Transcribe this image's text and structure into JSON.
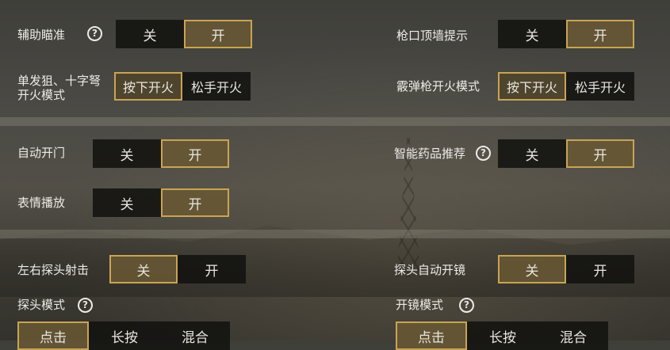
{
  "settings": {
    "aim_assist": {
      "label": "辅助瞄准",
      "off": "关",
      "on": "开"
    },
    "muzzle_wall_hint": {
      "label": "枪口顶墙提示",
      "off": "关",
      "on": "开"
    },
    "single_shot_fire": {
      "label_line1": "单发狙、十字弩",
      "label_line2": "开火模式",
      "press": "按下开火",
      "release": "松手开火"
    },
    "shotgun_fire": {
      "label": "霰弹枪开火模式",
      "press": "按下开火",
      "release": "松手开火"
    },
    "auto_door": {
      "label": "自动开门",
      "off": "关",
      "on": "开"
    },
    "smart_meds": {
      "label": "智能药品推荐",
      "off": "关",
      "on": "开"
    },
    "emote_play": {
      "label": "表情播放",
      "off": "关",
      "on": "开"
    },
    "peek_fire": {
      "label": "左右探头射击",
      "off": "关",
      "on": "开"
    },
    "peek_auto_scope": {
      "label": "探头自动开镜",
      "off": "关",
      "on": "开"
    },
    "peek_mode": {
      "label": "探头模式",
      "tap": "点击",
      "hold": "长按",
      "mixed": "混合"
    },
    "scope_mode": {
      "label": "开镜模式",
      "tap": "点击",
      "hold": "长按",
      "mixed": "混合"
    }
  },
  "help_glyph": "?",
  "accent_color": "#c9a453"
}
